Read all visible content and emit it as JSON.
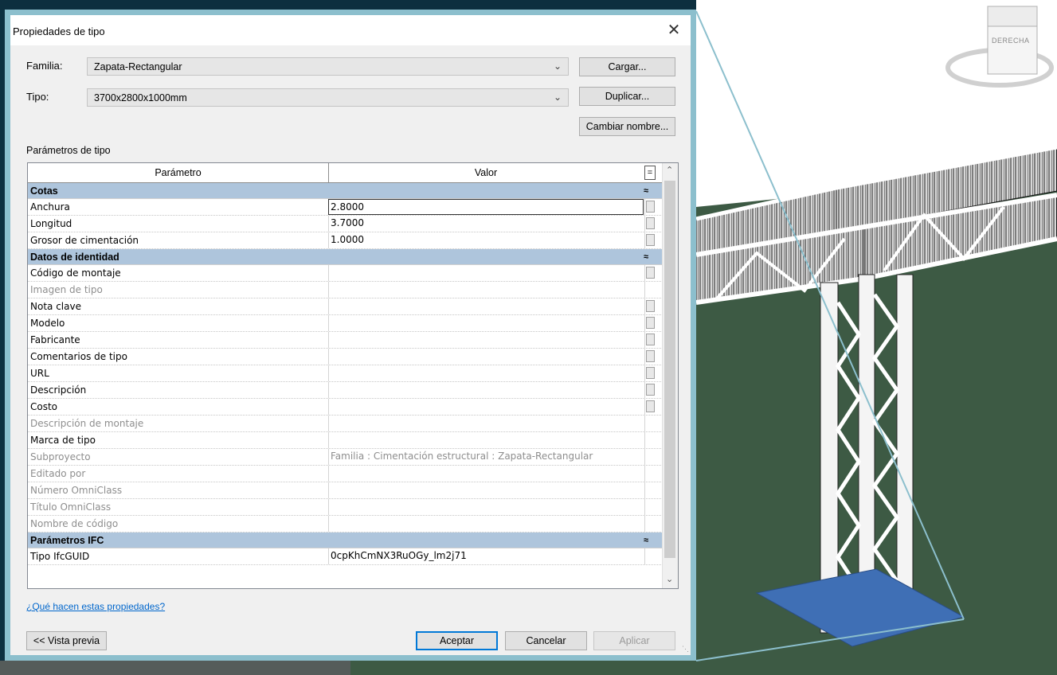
{
  "dialog": {
    "title": "Propiedades de tipo",
    "close_glyph": "✕",
    "family_label": "Familia:",
    "family_value": "Zapata-Rectangular",
    "type_label": "Tipo:",
    "type_value": "3700x2800x1000mm",
    "load_button": "Cargar...",
    "duplicate_button": "Duplicar...",
    "rename_button": "Cambiar nombre...",
    "section_label": "Parámetros de tipo",
    "help_link": "¿Qué hacen estas propiedades?",
    "preview_button": "<< Vista previa",
    "ok_button": "Aceptar",
    "cancel_button": "Cancelar",
    "apply_button": "Aplicar"
  },
  "grid": {
    "header_param": "Parámetro",
    "header_value": "Valor",
    "header_eq": "=",
    "collapse_glyph": "≈",
    "groups": [
      {
        "name": "Cotas",
        "rows": [
          {
            "param": "Anchura",
            "value": "2.8000",
            "dim": false,
            "check": true,
            "selected": true
          },
          {
            "param": "Longitud",
            "value": "3.7000",
            "dim": false,
            "check": true,
            "selected": false
          },
          {
            "param": "Grosor de cimentación",
            "value": "1.0000",
            "dim": false,
            "check": true,
            "selected": false
          }
        ]
      },
      {
        "name": "Datos de identidad",
        "rows": [
          {
            "param": "Código de montaje",
            "value": "",
            "dim": false,
            "check": true,
            "selected": false
          },
          {
            "param": "Imagen de tipo",
            "value": "",
            "dim": true,
            "check": false,
            "selected": false
          },
          {
            "param": "Nota clave",
            "value": "",
            "dim": false,
            "check": true,
            "selected": false
          },
          {
            "param": "Modelo",
            "value": "",
            "dim": false,
            "check": true,
            "selected": false
          },
          {
            "param": "Fabricante",
            "value": "",
            "dim": false,
            "check": true,
            "selected": false
          },
          {
            "param": "Comentarios de tipo",
            "value": "",
            "dim": false,
            "check": true,
            "selected": false
          },
          {
            "param": "URL",
            "value": "",
            "dim": false,
            "check": true,
            "selected": false
          },
          {
            "param": "Descripción",
            "value": "",
            "dim": false,
            "check": true,
            "selected": false
          },
          {
            "param": "Costo",
            "value": "",
            "dim": false,
            "check": true,
            "selected": false
          },
          {
            "param": "Descripción de montaje",
            "value": "",
            "dim": true,
            "check": false,
            "selected": false
          },
          {
            "param": "Marca de tipo",
            "value": "",
            "dim": false,
            "check": false,
            "selected": false
          },
          {
            "param": "Subproyecto",
            "value": "Familia  : Cimentación estructural : Zapata-Rectangular",
            "dim": true,
            "check": false,
            "selected": false
          },
          {
            "param": "Editado por",
            "value": "",
            "dim": true,
            "check": false,
            "selected": false
          },
          {
            "param": "Número OmniClass",
            "value": "",
            "dim": true,
            "check": false,
            "selected": false
          },
          {
            "param": "Título OmniClass",
            "value": "",
            "dim": true,
            "check": false,
            "selected": false
          },
          {
            "param": "Nombre de código",
            "value": "",
            "dim": true,
            "check": false,
            "selected": false
          }
        ]
      },
      {
        "name": "Parámetros IFC",
        "rows": [
          {
            "param": "Tipo IfcGUID",
            "value": "0cpKhCmNX3RuOGy_lm2j71",
            "dim": false,
            "check": false,
            "selected": false
          }
        ]
      }
    ]
  },
  "viewcube": {
    "face_label": "DERECHA"
  },
  "colors": {
    "dialog_border": "#8cbfcd",
    "group_header": "#aec5dc",
    "viewport_ground": "#3d5a44",
    "app_frame": "#0d2f3f"
  }
}
